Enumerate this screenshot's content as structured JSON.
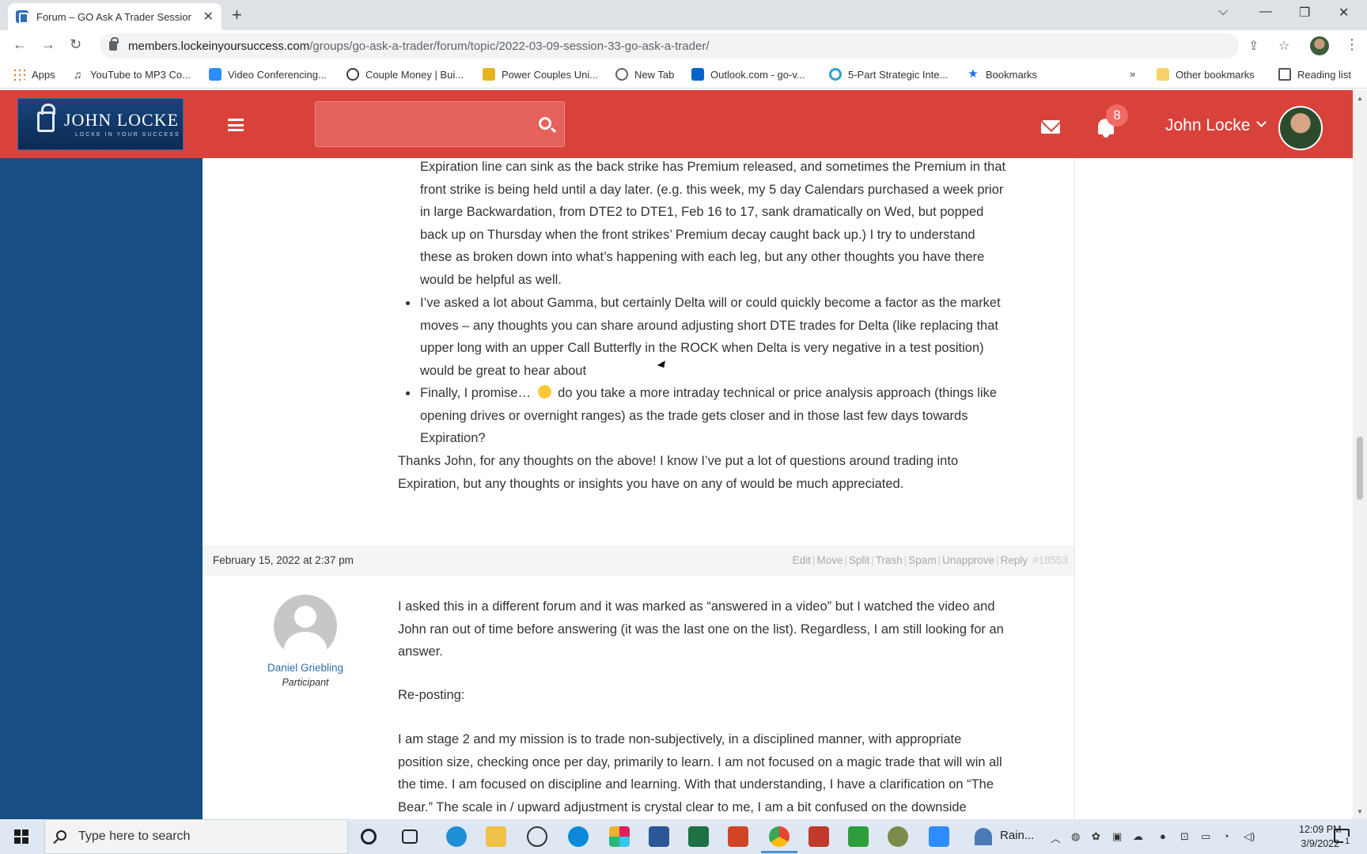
{
  "browser": {
    "tab_title": "Forum – GO Ask A Trader Session",
    "url_host": "members.lockeinyoursuccess.com",
    "url_path": "/groups/go-ask-a-trader/forum/topic/2022-03-09-session-33-go-ask-a-trader/",
    "bookmarks": [
      {
        "label": "Apps",
        "icon": "apps-grid-icon",
        "color": "#e37400"
      },
      {
        "label": "YouTube to MP3 Co...",
        "icon": "music-note-icon",
        "color": "#222222"
      },
      {
        "label": "Video Conferencing...",
        "icon": "zoom-icon",
        "color": "#2d8cff"
      },
      {
        "label": "Couple Money | Bui...",
        "icon": "wordpress-icon",
        "color": "#3c3c3c"
      },
      {
        "label": "Power Couples Uni...",
        "icon": "site-icon",
        "color": "#e6b422"
      },
      {
        "label": "New Tab",
        "icon": "globe-icon",
        "color": "#5f6368"
      },
      {
        "label": "Outlook.com - go-v...",
        "icon": "outlook-icon",
        "color": "#0a64c8"
      },
      {
        "label": "5-Part Strategic Inte...",
        "icon": "spiral-icon",
        "color": "#33a0c8"
      },
      {
        "label": "Bookmarks",
        "icon": "star-icon",
        "color": "#1a73e8"
      }
    ],
    "overflow": "»",
    "other_bookmarks": "Other bookmarks",
    "reading_list": "Reading list"
  },
  "site": {
    "logo_name": "JOHN LOCKE",
    "logo_tagline": "LOCKE IN YOUR SUCCESS",
    "notification_count": "8",
    "username": "John Locke"
  },
  "post": {
    "top_paragraph_lines": [
      "Expiration line can sink as the back strike has Premium released, and sometimes the Premium in that",
      "front strike is being held until a day later.  (e.g. this week, my 5 day Calendars purchased a week prior",
      "in large Backwardation, from DTE2 to DTE1, Feb 16 to 17, sank dramatically on Wed, but popped",
      "back up on Thursday when the front strikes’ Premium decay caught back up.)  I try to understand",
      "these as broken down into what’s happening with each leg, but any other thoughts you have there",
      "would be helpful as well."
    ],
    "bullet_2_lines": [
      "I’ve asked a lot about Gamma, but certainly Delta will or could quickly become a factor as the market",
      "moves – any thoughts you can share around adjusting short DTE trades for Delta (like replacing that",
      "upper long with an upper Call Butterfly in the ROCK when Delta is very negative in a test position)",
      "would be great to hear about"
    ],
    "bullet_3_start": "Finally, I promise…",
    "bullet_3_rest": "do you take a more intraday technical or price analysis approach (things like",
    "bullet_3_lines": [
      "opening drives or overnight ranges) as the trade gets closer and in those last few days towards",
      "Expiration?"
    ],
    "closing_lines": [
      "Thanks John, for any thoughts on the above!  I know I’ve put a lot of questions around trading into",
      "Expiration, but any thoughts or insights you have on any of would be much appreciated."
    ]
  },
  "reply": {
    "date": "February 15, 2022 at 2:37 pm",
    "actions": {
      "edit": "Edit",
      "move": "Move",
      "split": "Split",
      "trash": "Trash",
      "spam": "Spam",
      "unapprove": "Unapprove",
      "reply": "Reply",
      "id": "#18553"
    },
    "separator": "|",
    "author_name": "Daniel Griebling",
    "author_role": "Participant",
    "paragraph_1_lines": [
      "I asked this in a different forum and it was marked as “answered in a video” but I watched the video and",
      "John ran out of time before answering (it was the last one on the list). Regardless, I am still looking for an",
      "answer."
    ],
    "reposting": "Re-posting:",
    "paragraph_2_lines": [
      "I am stage 2 and my mission is to trade non-subjectively, in a disciplined manner, with appropriate",
      "position size, checking once per day, primarily to learn. I am not focused on a magic trade that will win all",
      "the time. I am focused on discipline and learning. With that understanding, I have a clarification on “The",
      "Bear.” The scale in / upward adjustment is crystal clear to me, I am a bit confused on the downside"
    ]
  },
  "taskbar": {
    "search_placeholder": "Type here to search",
    "weather": "Rain...",
    "time": "12:09 PM",
    "date": "3/9/2022",
    "notification_count": "1"
  },
  "colors": {
    "header_red": "#d9423a",
    "sidebar_blue": "#174f84",
    "link_blue": "#2c6fad"
  }
}
